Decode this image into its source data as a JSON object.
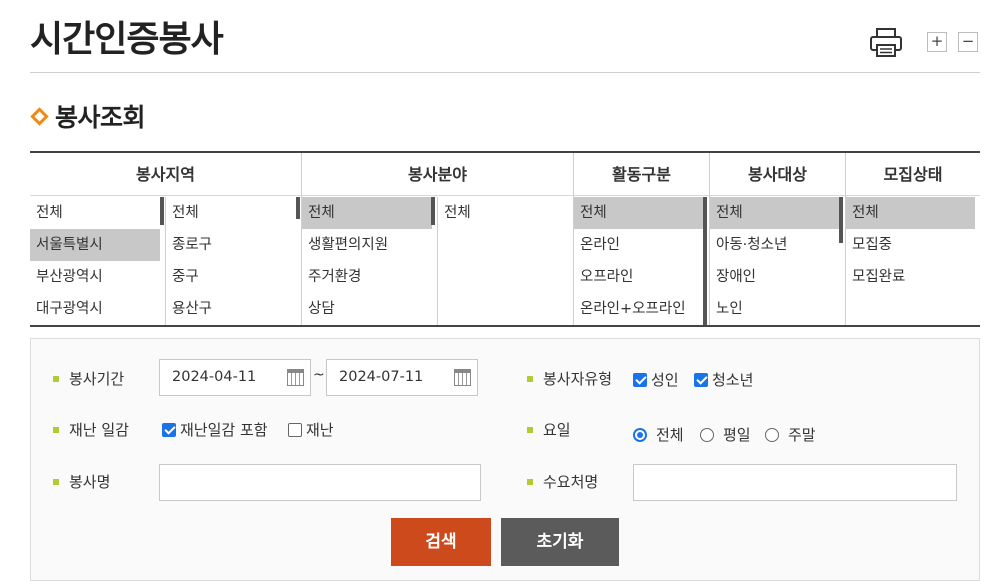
{
  "page": {
    "title": "시간인증봉사",
    "zoom_in": "+",
    "zoom_out": "−"
  },
  "section": {
    "title": "봉사조회"
  },
  "filter": {
    "headers": [
      "봉사지역",
      "봉사분야",
      "활동구분",
      "봉사대상",
      "모집상태"
    ],
    "region_sido": [
      "전체",
      "서울특별시",
      "부산광역시",
      "대구광역시"
    ],
    "region_gu": [
      "전체",
      "종로구",
      "중구",
      "용산구"
    ],
    "field_main": [
      "전체",
      "생활편의지원",
      "주거환경",
      "상담"
    ],
    "field_sub": [
      "전체"
    ],
    "activity": [
      "전체",
      "온라인",
      "오프라인",
      "온라인+오프라인"
    ],
    "target": [
      "전체",
      "아동·청소년",
      "장애인",
      "노인"
    ],
    "status": [
      "전체",
      "모집중",
      "모집완료"
    ]
  },
  "form": {
    "period_label": "봉사기간",
    "date_from": "2024-04-11",
    "date_sep": "~",
    "date_to": "2024-07-11",
    "volunteer_type_label": "봉사자유형",
    "type_adult": "성인",
    "type_youth": "청소년",
    "disaster_label": "재난 일감",
    "disaster_include": "재난일감 포함",
    "disaster_only": "재난",
    "day_label": "요일",
    "day_all": "전체",
    "day_weekday": "평일",
    "day_weekend": "주말",
    "name_label": "봉사명",
    "name_value": "",
    "client_label": "수요처명",
    "client_value": "",
    "search_button": "검색",
    "reset_button": "초기화"
  },
  "colors": {
    "accent_orange": "#f08a17",
    "search_button": "#cc4a1c",
    "reset_button": "#5b5b5b",
    "bullet": "#b5c934",
    "check_blue": "#1a73e8"
  }
}
